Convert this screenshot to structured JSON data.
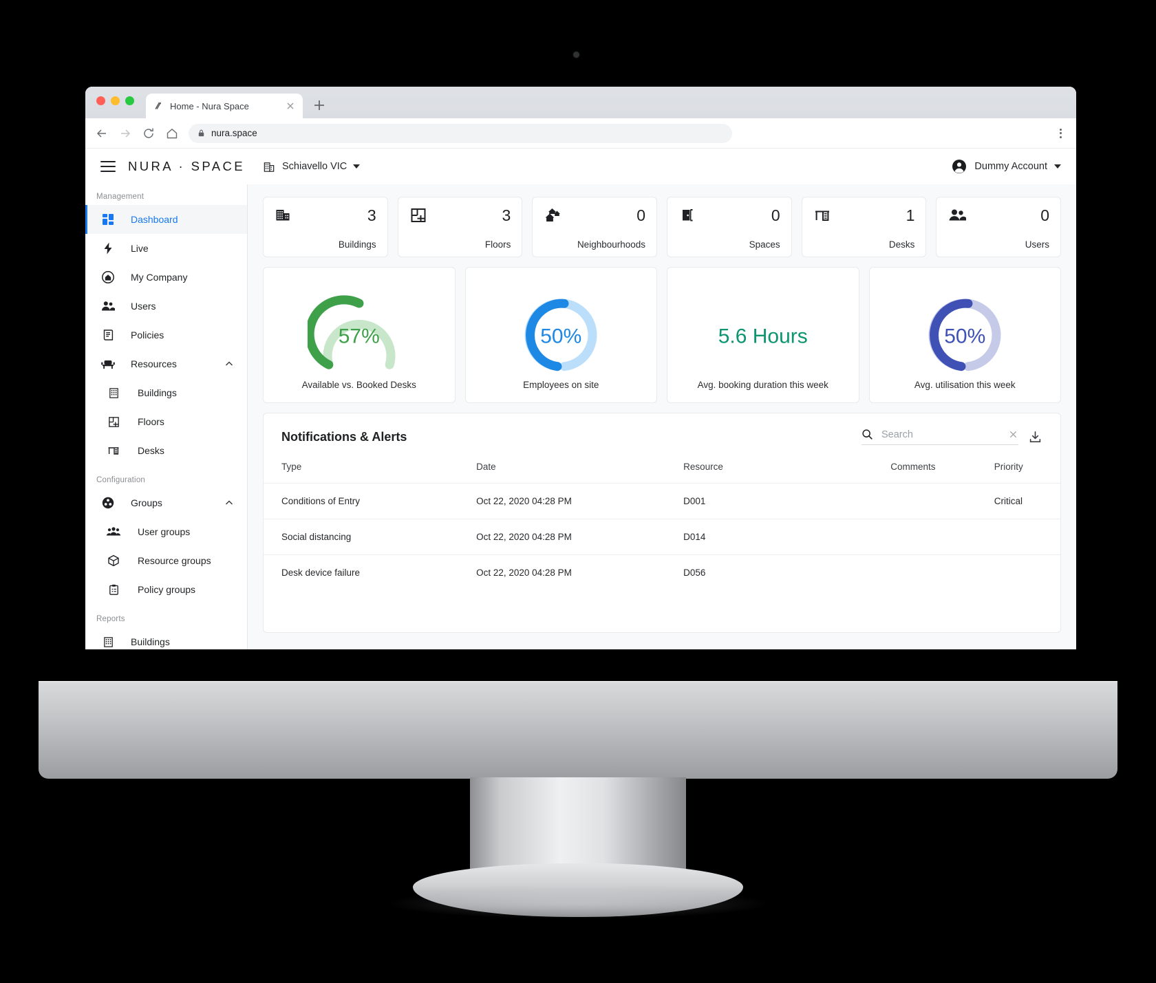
{
  "browser": {
    "tab_title": "Home - Nura Space",
    "tab_favicon_icon": "nura-logo-icon",
    "new_tab_icon": "plus-icon",
    "close_tab_icon": "close-icon",
    "back_icon": "arrow-left-icon",
    "forward_icon": "arrow-right-icon",
    "reload_icon": "reload-icon",
    "home_icon": "home-icon",
    "lock_icon": "lock-icon",
    "url": "nura.space",
    "menu_icon": "kebab-menu-icon"
  },
  "appbar": {
    "menu_icon": "hamburger-icon",
    "brand": "NURA · SPACE",
    "site_icon": "building-icon",
    "site_name": "Schiavello VIC",
    "site_caret_icon": "chevron-down-icon",
    "account_icon": "account-circle-icon",
    "account_name": "Dummy Account",
    "account_caret_icon": "chevron-down-icon"
  },
  "sidebar": {
    "sections": [
      {
        "label": "Management",
        "items": [
          {
            "label": "Dashboard",
            "icon": "dashboard-icon",
            "active": true,
            "sub": false
          },
          {
            "label": "Live",
            "icon": "bolt-icon",
            "active": false,
            "sub": false
          },
          {
            "label": "My Company",
            "icon": "home-circle-icon",
            "active": false,
            "sub": false
          },
          {
            "label": "Users",
            "icon": "people-icon",
            "active": false,
            "sub": false
          },
          {
            "label": "Policies",
            "icon": "policy-icon",
            "active": false,
            "sub": false
          },
          {
            "label": "Resources",
            "icon": "chair-icon",
            "active": false,
            "sub": false,
            "expanded": true,
            "chevron": "chevron-up-icon"
          },
          {
            "label": "Buildings",
            "icon": "building-icon",
            "active": false,
            "sub": true
          },
          {
            "label": "Floors",
            "icon": "floorplan-icon",
            "active": false,
            "sub": true
          },
          {
            "label": "Desks",
            "icon": "desk-icon",
            "active": false,
            "sub": true
          }
        ]
      },
      {
        "label": "Configuration",
        "items": [
          {
            "label": "Groups",
            "icon": "groups-icon",
            "active": false,
            "sub": false,
            "expanded": true,
            "chevron": "chevron-up-icon"
          },
          {
            "label": "User groups",
            "icon": "people-group-icon",
            "active": false,
            "sub": true
          },
          {
            "label": "Resource groups",
            "icon": "cube-icon",
            "active": false,
            "sub": true
          },
          {
            "label": "Policy groups",
            "icon": "clipboard-icon",
            "active": false,
            "sub": true
          }
        ]
      },
      {
        "label": "Reports",
        "items": [
          {
            "label": "Buildings",
            "icon": "building-icon",
            "active": false,
            "sub": false
          }
        ]
      }
    ]
  },
  "stats": [
    {
      "value": "3",
      "label": "Buildings",
      "icon": "building-icon"
    },
    {
      "value": "3",
      "label": "Floors",
      "icon": "floorplan-icon"
    },
    {
      "value": "0",
      "label": "Neighbourhoods",
      "icon": "neighbourhood-icon"
    },
    {
      "value": "0",
      "label": "Spaces",
      "icon": "door-icon"
    },
    {
      "value": "1",
      "label": "Desks",
      "icon": "desk-icon"
    },
    {
      "value": "0",
      "label": "Users",
      "icon": "people-icon"
    }
  ],
  "chart_data": [
    {
      "type": "pie",
      "subtype": "gauge-3quarter",
      "title": "Available vs. Booked Desks",
      "value": 57,
      "display": "57%",
      "max": 100,
      "color": "#3fa04a",
      "track_color": "#c8e6c9"
    },
    {
      "type": "pie",
      "subtype": "donut",
      "title": "Employees on site",
      "value": 50,
      "display": "50%",
      "max": 100,
      "color": "#1e88e5",
      "track_color": "#bbdefb"
    },
    {
      "type": "table",
      "subtype": "value",
      "title": "Avg. booking duration this week",
      "display": "5.6 Hours",
      "value": 5.6,
      "unit": "Hours",
      "color": "#0d9470"
    },
    {
      "type": "pie",
      "subtype": "donut",
      "title": "Avg. utilisation this week",
      "value": 50,
      "display": "50%",
      "max": 100,
      "color": "#3f51b5",
      "track_color": "#c5cae9"
    }
  ],
  "notifications": {
    "title": "Notifications & Alerts",
    "search_icon": "search-icon",
    "search_placeholder": "Search",
    "search_value": "",
    "clear_icon": "close-icon",
    "download_icon": "download-icon",
    "columns": [
      "Type",
      "Date",
      "Resource",
      "Comments",
      "Priority"
    ],
    "rows": [
      {
        "type": "Conditions of Entry",
        "date": "Oct 22, 2020 04:28 PM",
        "resource": "D001",
        "comments": "",
        "priority": "Critical"
      },
      {
        "type": "Social distancing",
        "date": "Oct 22, 2020 04:28 PM",
        "resource": "D014",
        "comments": "",
        "priority": ""
      },
      {
        "type": "Desk device failure",
        "date": "Oct 22, 2020 04:28 PM",
        "resource": "D056",
        "comments": "",
        "priority": ""
      }
    ]
  }
}
